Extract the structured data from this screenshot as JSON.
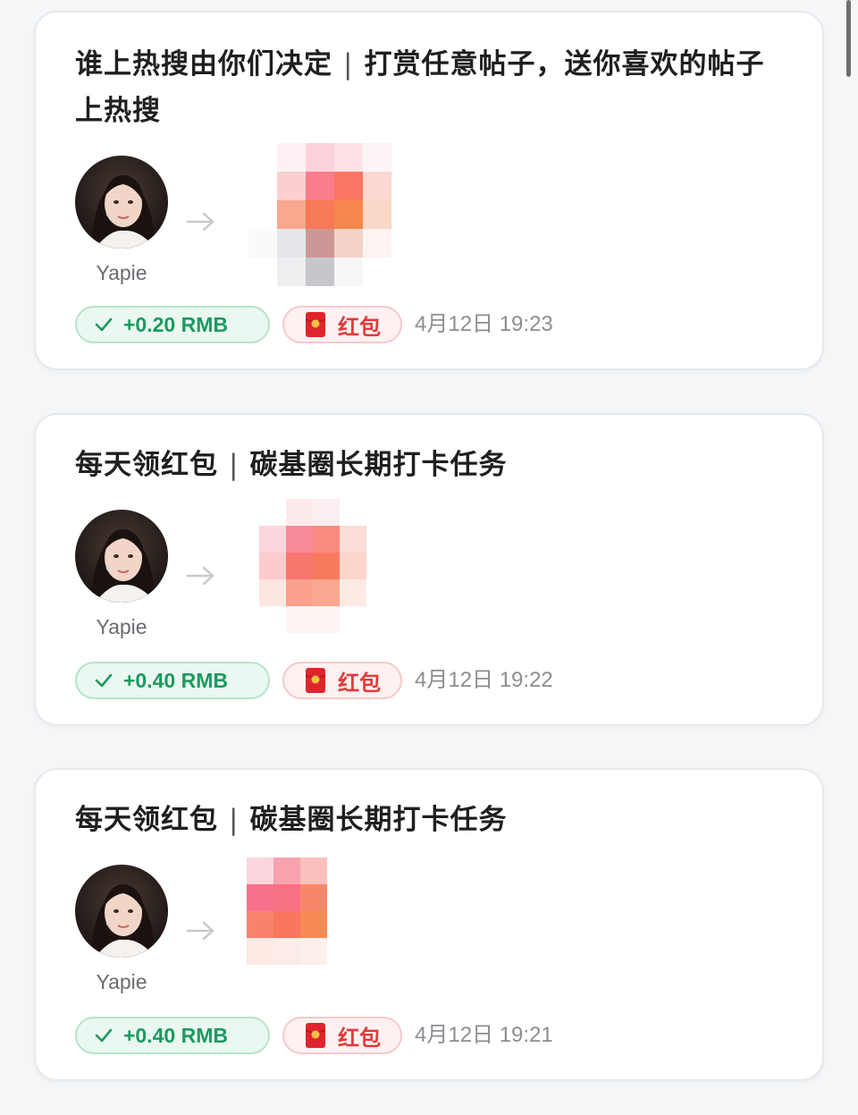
{
  "feed": [
    {
      "title": "谁上热搜由你们决定",
      "subtitle": "打赏任意帖子，送你喜欢的帖子上热搜",
      "sender": "Yapie",
      "amount": "+0.20 RMB",
      "badge": "红包",
      "time": "4月12日 19:23"
    },
    {
      "title": "每天领红包",
      "subtitle": "碳基圈长期打卡任务",
      "sender": "Yapie",
      "amount": "+0.40 RMB",
      "badge": "红包",
      "time": "4月12日 19:22"
    },
    {
      "title": "每天领红包",
      "subtitle": "碳基圈长期打卡任务",
      "sender": "Yapie",
      "amount": "+0.40 RMB",
      "badge": "红包",
      "time": "4月12日 19:21"
    }
  ],
  "icons": {
    "check": "check-icon",
    "arrow": "arrow-right-icon",
    "packet": "red-packet-icon"
  },
  "colors": {
    "amount_green": "#1c9a5e",
    "packet_red": "#e23a3a"
  }
}
